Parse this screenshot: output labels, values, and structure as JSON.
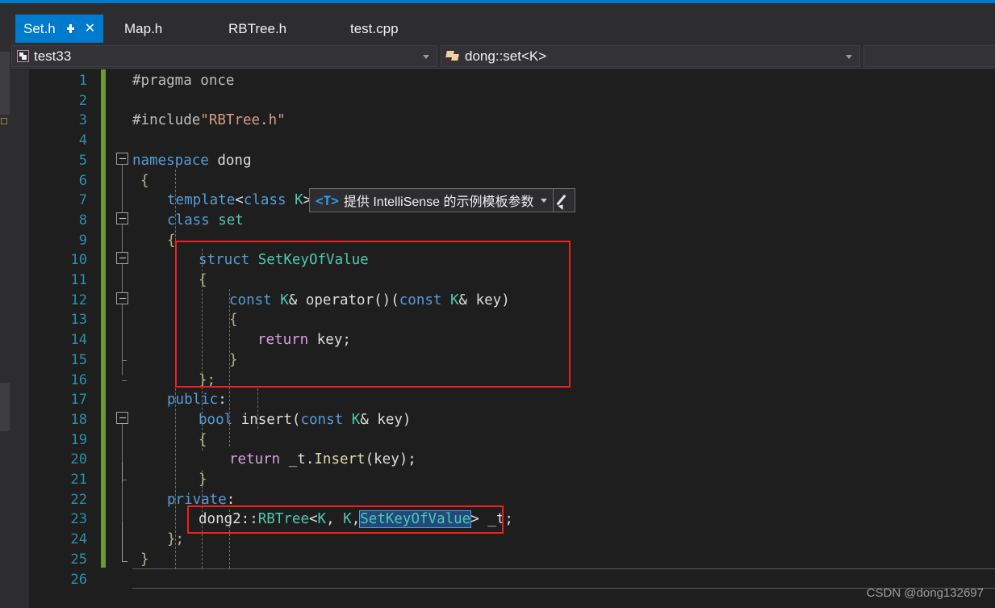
{
  "window": {
    "accent_color": "#007acc",
    "background": "#1e1e1e"
  },
  "tabs": [
    {
      "label": "Set.h",
      "active": true,
      "pin_icon": "pin-icon",
      "close_icon": "close-icon"
    },
    {
      "label": "Map.h",
      "active": false
    },
    {
      "label": "RBTree.h",
      "active": false
    },
    {
      "label": "test.cpp",
      "active": false
    }
  ],
  "navbar": {
    "project": {
      "icon": "project-icon",
      "value": "test33",
      "dropdown_icon": "chevron-down-icon"
    },
    "scope": {
      "icon": "class-member-icon",
      "value": "dong::set<K>",
      "dropdown_icon": "chevron-down-icon"
    },
    "member": {
      "value": "",
      "dropdown_icon": "chevron-down-icon"
    }
  },
  "intellisense_tooltip": {
    "tag": "<T>",
    "text": "提供 IntelliSense 的示例模板参数",
    "dropdown_icon": "chevron-down-icon",
    "edit_icon": "pencil-icon"
  },
  "editor": {
    "line_numbers": [
      "1",
      "2",
      "3",
      "4",
      "5",
      "6",
      "7",
      "8",
      "9",
      "10",
      "11",
      "12",
      "13",
      "14",
      "15",
      "16",
      "17",
      "18",
      "19",
      "20",
      "21",
      "22",
      "23",
      "24",
      "25",
      "26"
    ],
    "line_number_color": "#2b91af",
    "change_bar_color": "#6a9a36",
    "selection_text": "SetKeyOfValue",
    "lines": [
      {
        "n": 1,
        "text": "#pragma once"
      },
      {
        "n": 2,
        "text": ""
      },
      {
        "n": 3,
        "text": "#include\"RBTree.h\""
      },
      {
        "n": 4,
        "text": ""
      },
      {
        "n": 5,
        "text": "namespace dong"
      },
      {
        "n": 6,
        "text": "{"
      },
      {
        "n": 7,
        "text": "    template<class K>"
      },
      {
        "n": 8,
        "text": "    class set"
      },
      {
        "n": 9,
        "text": "    {"
      },
      {
        "n": 10,
        "text": "        struct SetKeyOfValue"
      },
      {
        "n": 11,
        "text": "        {"
      },
      {
        "n": 12,
        "text": "            const K& operator()(const K& key)"
      },
      {
        "n": 13,
        "text": "            {"
      },
      {
        "n": 14,
        "text": "                return key;"
      },
      {
        "n": 15,
        "text": "            }"
      },
      {
        "n": 16,
        "text": "        };"
      },
      {
        "n": 17,
        "text": "    public:"
      },
      {
        "n": 18,
        "text": "        bool insert(const K& key)"
      },
      {
        "n": 19,
        "text": "        {"
      },
      {
        "n": 20,
        "text": "            return _t.Insert(key);"
      },
      {
        "n": 21,
        "text": "        }"
      },
      {
        "n": 22,
        "text": "    private:"
      },
      {
        "n": 23,
        "text": "        dong2::RBTree<K, K,SetKeyOfValue> _t;"
      },
      {
        "n": 24,
        "text": "    };"
      },
      {
        "n": 25,
        "text": "}"
      },
      {
        "n": 26,
        "text": ""
      }
    ],
    "syntax_colors": {
      "keyword": "#569cd6",
      "type": "#4ec9b0",
      "return_keyword": "#d8a0df",
      "string": "#d69d85",
      "function": "#dcdcaa",
      "identifier": "#dcdcdc",
      "preprocessor": "#bfbfbf",
      "brace": "#b4b48a"
    },
    "annotations": [
      {
        "name": "struct-setkeyofvalue-highlight",
        "color": "#f02020"
      },
      {
        "name": "rbtree-member-highlight",
        "color": "#f02020"
      }
    ]
  },
  "code_tokens": {
    "l1_pragma": "#pragma once",
    "l3_include": "#include",
    "l3_string": "\"RBTree.h\"",
    "l5_kw": "namespace",
    "l5_name": " dong",
    "l6_brace": "{",
    "l7_kw": "template",
    "l7_lt": "<",
    "l7_class": "class",
    "l7_k": " K",
    "l7_gt": ">",
    "l8_kw": "class",
    "l8_name": " set",
    "l9_brace": "{",
    "l10_kw": "struct",
    "l10_name": " SetKeyOfValue",
    "l11_brace": "{",
    "l12_const": "const",
    "l12_k": " K",
    "l12_amp": "& ",
    "l12_op": "operator",
    "l12_parens": "()(",
    "l12_const2": "const",
    "l12_k2": " K",
    "l12_amp2": "& ",
    "l12_key": "key)",
    "l13_brace": "{",
    "l14_return": "return",
    "l14_key": " key;",
    "l15_brace": "}",
    "l16_brace": "};",
    "l17_public": "public",
    "l17_colon": ":",
    "l18_bool": "bool",
    "l18_insert": " insert",
    "l18_p1": "(",
    "l18_const": "const",
    "l18_k": " K",
    "l18_amp": "& ",
    "l18_key": "key)",
    "l19_brace": "{",
    "l20_return": "return",
    "l20_t": " _t.",
    "l20_insert": "Insert",
    "l20_key": "(key);",
    "l21_brace": "}",
    "l22_private": "private",
    "l22_colon": ":",
    "l23_ns": "dong2::",
    "l23_rbtree": "RBTree",
    "l23_lt": "<",
    "l23_k1": "K",
    "l23_comma1": ", ",
    "l23_k2": "K",
    "l23_comma2": ",",
    "l23_sel": "SetKeyOfValue",
    "l23_gt": ">",
    "l23_t": " _t;",
    "l24_brace": "};",
    "l25_brace": "}"
  },
  "watermark": "CSDN @dong132697"
}
